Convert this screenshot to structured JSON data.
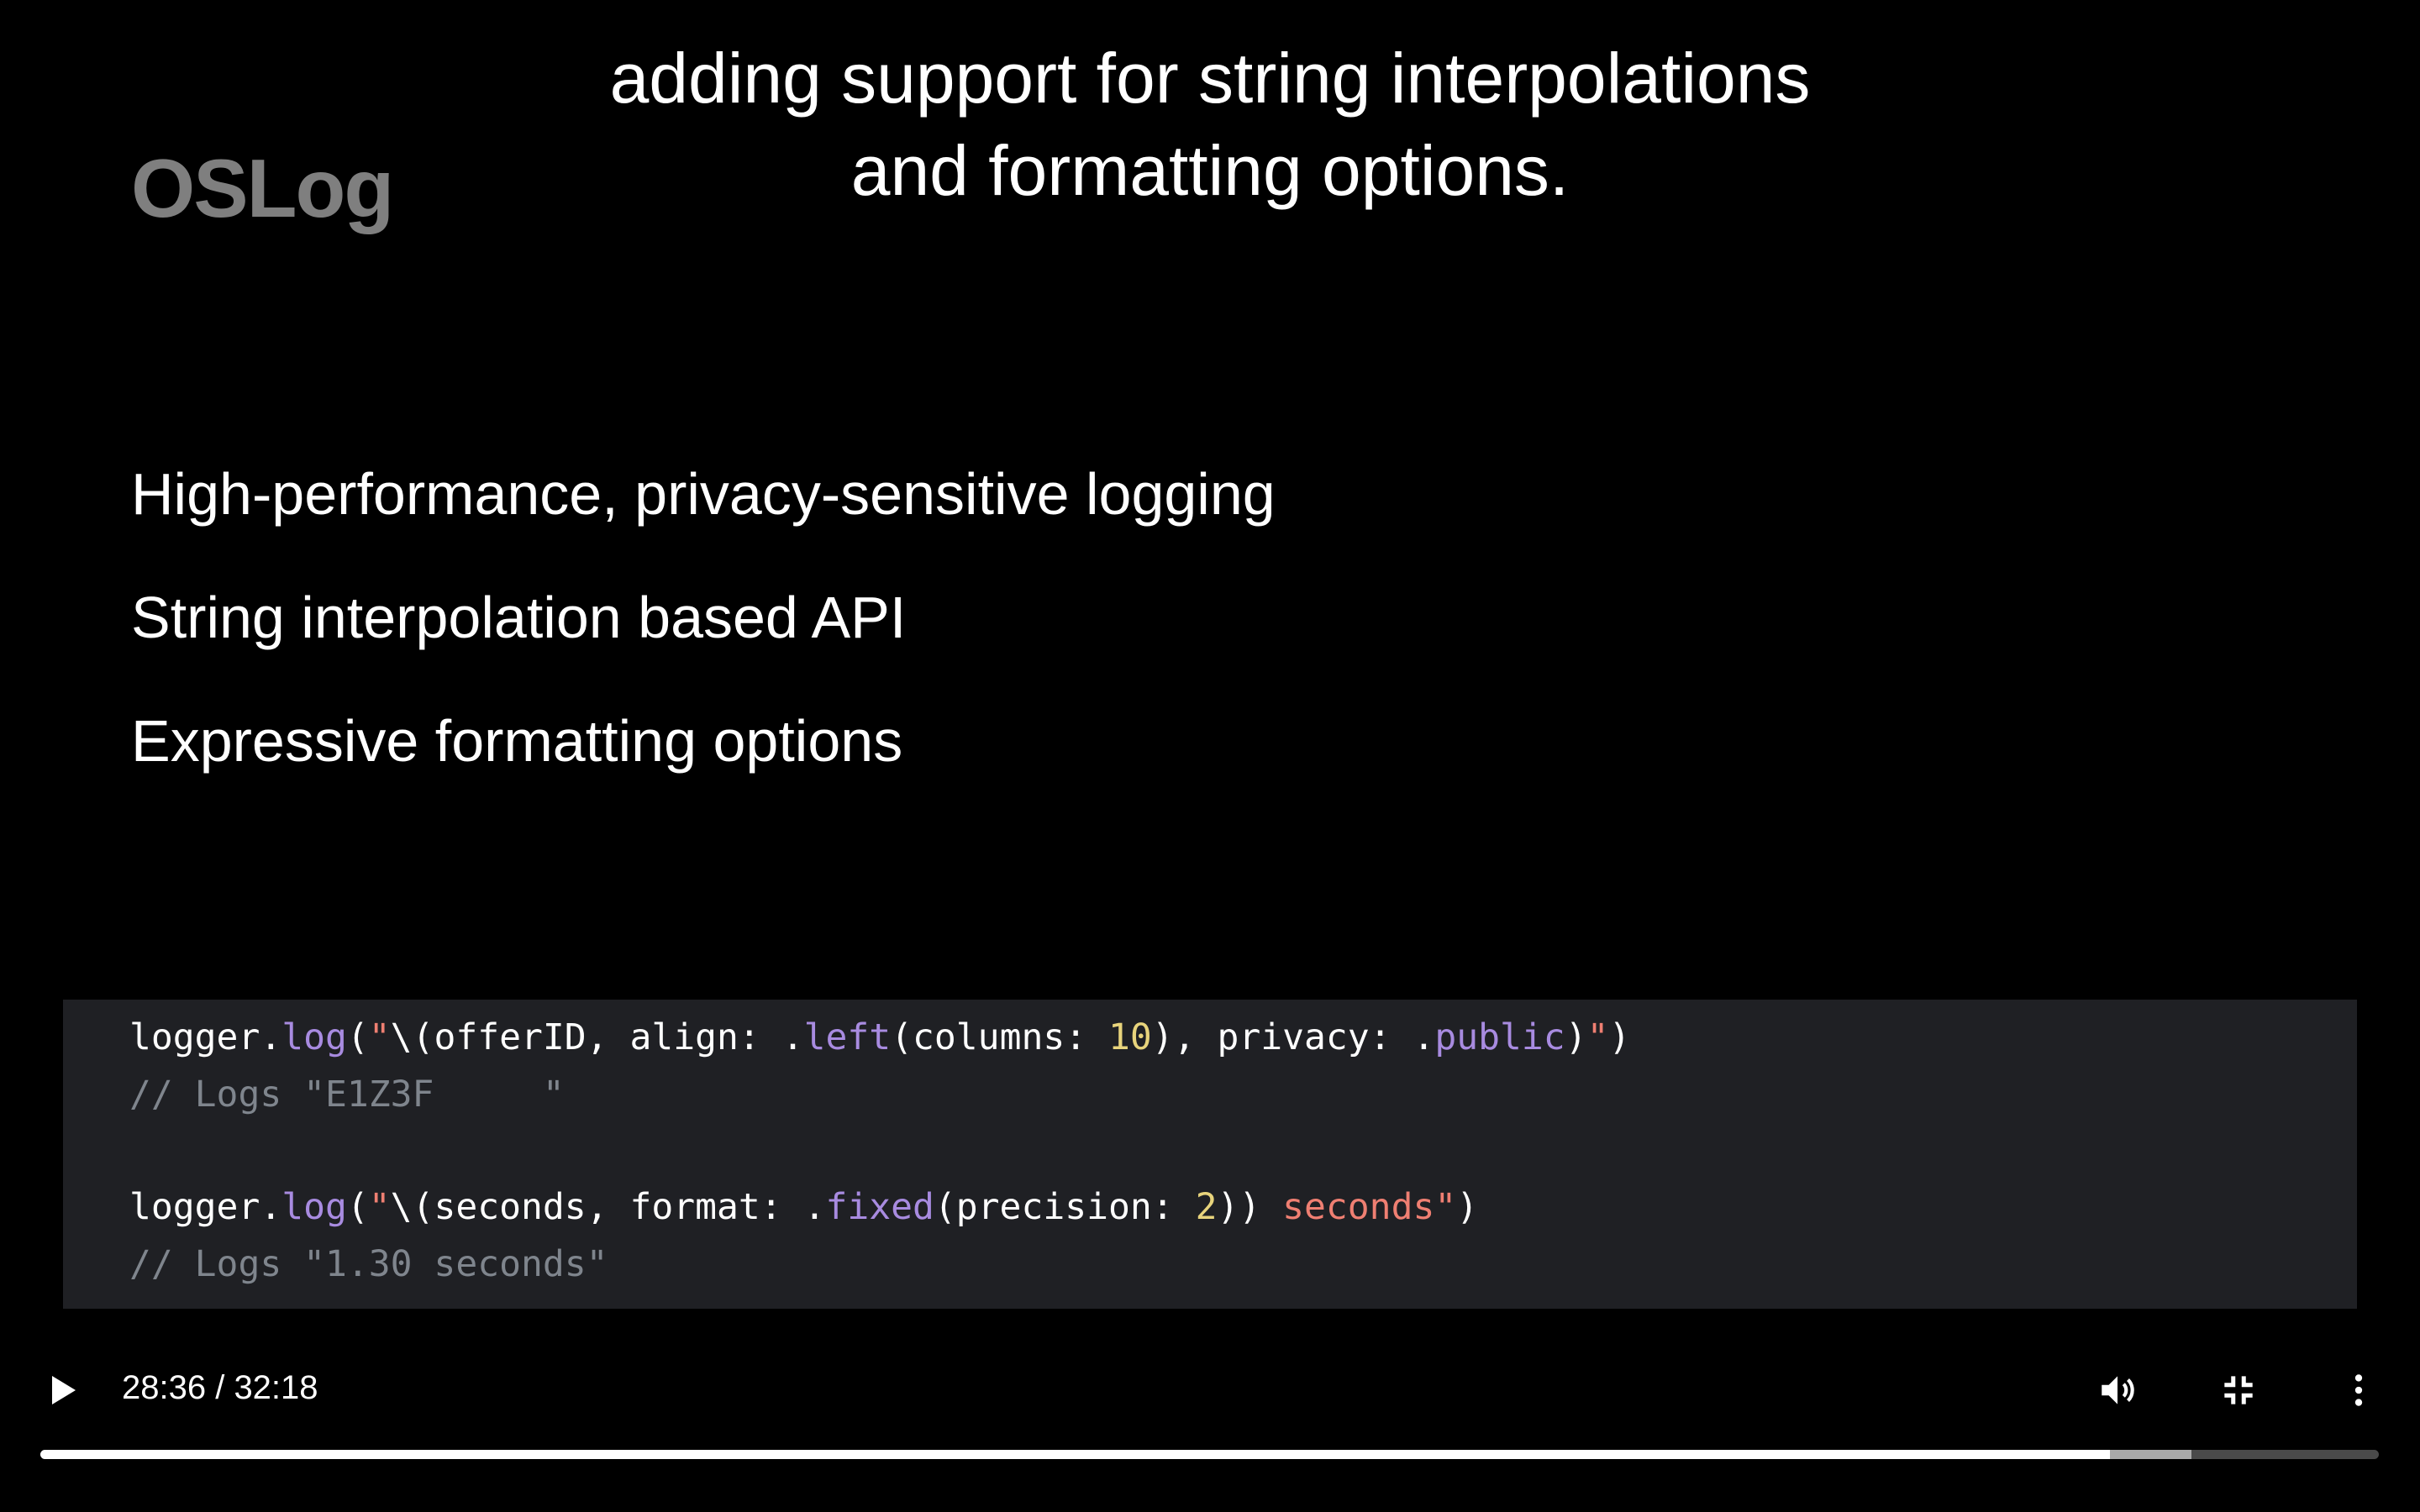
{
  "subtitle": {
    "line1": "adding support for string interpolations",
    "line2": "and formatting options."
  },
  "slide": {
    "title": "OSLog",
    "bullets": [
      "High-performance, privacy-sensitive logging",
      "String interpolation based API",
      "Expressive formatting options"
    ],
    "code": {
      "l1": [
        "logger.",
        "log",
        "(",
        "\"",
        "\\(offerID, align: .",
        "left",
        "(columns: ",
        "10",
        "), privacy: .",
        "public",
        ")",
        "\"",
        ")"
      ],
      "l2": "// Logs \"E1Z3F     \"",
      "l3": [
        "logger.",
        "log",
        "(",
        "\"",
        "\\(seconds, format: .",
        "fixed",
        "(precision: ",
        "2",
        ")) ",
        "seconds\"",
        ")"
      ],
      "l4": "// Logs \"1.30 seconds\""
    }
  },
  "player": {
    "time": "28:36 / 32:18",
    "progress": 0.885,
    "buffered": 0.92,
    "icons": [
      "play-icon",
      "volume-icon",
      "exit-fullscreen-icon",
      "more-icon"
    ]
  }
}
